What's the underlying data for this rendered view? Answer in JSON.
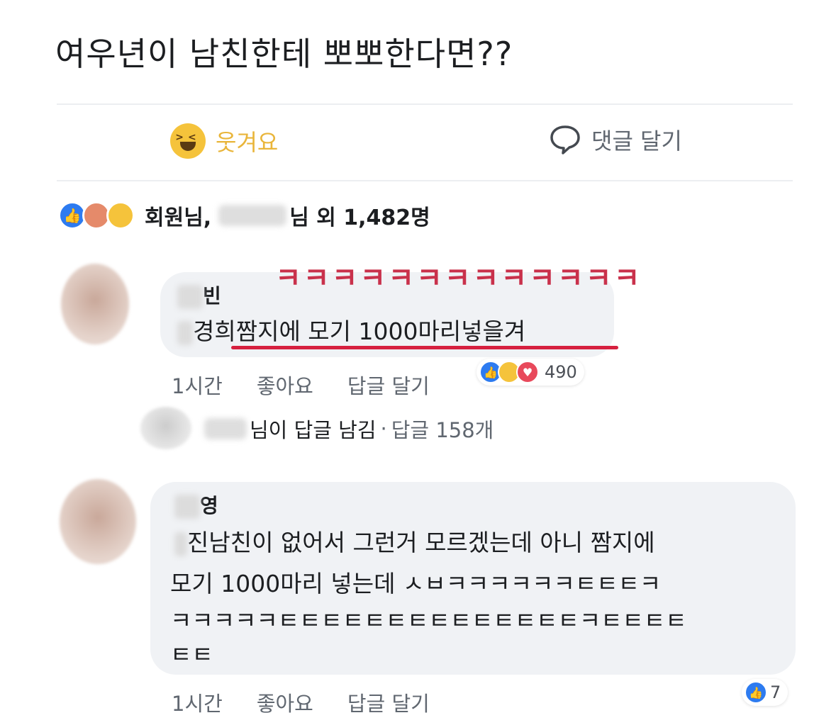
{
  "post": {
    "title": "여우년이 남친한테 뽀뽀한다면??"
  },
  "actions": {
    "laugh_label": "웃겨요",
    "comment_label": "댓글 달기"
  },
  "reactions": {
    "name1": "회원님,",
    "suffix": "님 외 1,482명"
  },
  "comments": [
    {
      "name_suffix": "빈",
      "text": "경희짬지에 모기 1000마리넣을겨",
      "time": "1시간",
      "like": "좋아요",
      "reply": "답글 달기",
      "reaction_count": "490"
    },
    {
      "name_suffix": "영",
      "lines": [
        "진남친이 없어서 그런거 모르겠는데 아니 짬지에",
        "모기 1000마리 넣는데 ㅅㅂㅋㅋㅋㅋㅋㅋㅌㅌㅌㅋ",
        "ㅋㅋㅋㅋㅋㅌㅌㅌㅌㅌㅌㅌㅌㅌㅌㅌㅌㅌㅌㅋㅌㅌㅌㅌ",
        "ㅌㅌ"
      ],
      "time": "1시간",
      "like": "좋아요",
      "reply": "답글 달기",
      "reaction_count": "7"
    }
  ],
  "reply_summary": {
    "text": "님이 답글 남김",
    "count": "답글 158개"
  },
  "overlay": {
    "kk": "ㅋㅋㅋㅋㅋㅋㅋㅋㅋㅋㅋㅋㅋ",
    "color": "#c9314b"
  }
}
